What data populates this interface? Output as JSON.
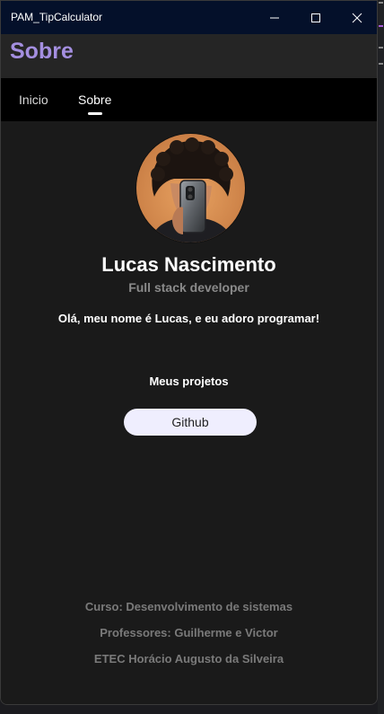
{
  "window": {
    "title": "PAM_TipCalculator"
  },
  "header": {
    "title": "Sobre"
  },
  "tabs": [
    {
      "label": "Inicio",
      "selected": false
    },
    {
      "label": "Sobre",
      "selected": true
    }
  ],
  "profile": {
    "name": "Lucas Nascimento",
    "role": "Full stack developer",
    "intro": "Olá, meu nome é Lucas, e eu adoro programar!"
  },
  "projects": {
    "heading": "Meus projetos",
    "github_label": "Github"
  },
  "footer": {
    "course": "Curso: Desenvolvimento de sistemas",
    "teachers": "Professores: Guilherme e Victor",
    "school": "ETEC Horácio Augusto da Silveira"
  },
  "colors": {
    "accent": "#a48fe0",
    "titlebar": "#04102a",
    "button_bg": "#efeefe"
  },
  "icons": [
    "minimize-icon",
    "maximize-icon",
    "close-icon",
    "profile-photo"
  ]
}
